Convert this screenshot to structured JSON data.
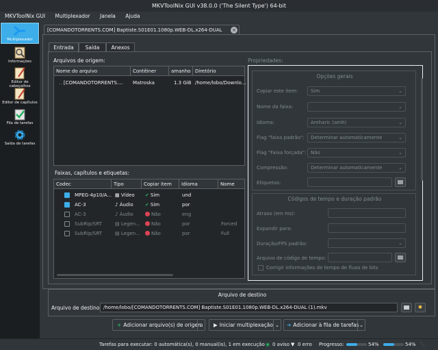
{
  "window": {
    "title": "MKVToolNix GUI v38.0.0 ('The Silent Type') 64-bit"
  },
  "menu": [
    "MKVToolNix GUI",
    "Multiplexador",
    "Janela",
    "Ajuda"
  ],
  "sidebar": [
    {
      "label": "Multiplexador",
      "icon": "multiplexer-icon",
      "active": true
    },
    {
      "label": "Informações",
      "icon": "info-icon"
    },
    {
      "label": "Editor de cabeçalhos",
      "icon": "header-editor-icon"
    },
    {
      "label": "Editor de capítulos",
      "icon": "chapter-editor-icon"
    },
    {
      "label": "Fila de tarefas",
      "icon": "job-queue-icon"
    },
    {
      "label": "Saída de tarefas",
      "icon": "job-output-icon"
    }
  ],
  "doc_tab": {
    "label": "[COMANDOTORRENTS.COM] Baptiste.S01E01.1080p.WEB-DL.x264-DUAL (1).mkv"
  },
  "subtabs": [
    "Entrada",
    "Saída",
    "Anexos"
  ],
  "source_files": {
    "label": "Arquivos de origem:",
    "columns": [
      "Nome do arquivo",
      "Contêiner",
      "amanho",
      "Diretório"
    ],
    "rows": [
      {
        "name": "[COMANDOTORRENTS....",
        "container": "Matroska",
        "size": "1.3 GiB",
        "dir": "/home/lobo/Downlo..."
      }
    ]
  },
  "tracks": {
    "label": "Faixas, capítulos e etiquetas:",
    "columns": [
      "Codec",
      "Tipo",
      "Copiar item",
      "Idioma",
      "Nome"
    ],
    "rows": [
      {
        "codec": "MPEG-4p10/A...",
        "type": "Vídeo",
        "copy": "Sim",
        "lang": "und",
        "name": "",
        "checked": true,
        "enabled": true
      },
      {
        "codec": "AC-3",
        "type": "Áudio",
        "copy": "Sim",
        "lang": "por",
        "name": "",
        "checked": true,
        "enabled": true
      },
      {
        "codec": "AC-3",
        "type": "Áudio",
        "copy": "Não",
        "lang": "eng",
        "name": "",
        "checked": false,
        "enabled": false
      },
      {
        "codec": "SubRip/SRT",
        "type": "Legen...",
        "copy": "Não",
        "lang": "por",
        "name": "Forced",
        "checked": false,
        "enabled": false
      },
      {
        "codec": "SubRip/SRT",
        "type": "Legen...",
        "copy": "Não",
        "lang": "por",
        "name": "Full",
        "checked": false,
        "enabled": false
      }
    ]
  },
  "properties": {
    "label": "Propriedades:",
    "general_title": "Opções gerais",
    "general": [
      {
        "label": "Copiar este item:",
        "value": "Sim",
        "kind": "select"
      },
      {
        "label": "Nome da faixa:",
        "value": "",
        "kind": "select"
      },
      {
        "label": "Idioma:",
        "value": "Amharic (amh)",
        "kind": "select"
      },
      {
        "label": "Flag \"faixa padrão\":",
        "value": "Determinar automaticamente",
        "kind": "select"
      },
      {
        "label": "Flag \"Faixa forçada\":",
        "value": "Não",
        "kind": "select"
      },
      {
        "label": "Compressão:",
        "value": "Determinar automaticamente",
        "kind": "select"
      },
      {
        "label": "Etiquetas:",
        "value": "",
        "kind": "file"
      }
    ],
    "timing_title": "Códigos de tempo e duração padrão",
    "timing": [
      {
        "label": "Atraso (em ms):",
        "value": "",
        "kind": "text"
      },
      {
        "label": "Expandir para:",
        "value": "",
        "kind": "text"
      },
      {
        "label": "Duração/FPS padrão:",
        "value": "",
        "kind": "select"
      },
      {
        "label": "Arquivo de código de tempo:",
        "value": "",
        "kind": "file"
      }
    ],
    "fix_timing_label": "Corrigir informações de tempo de fluxo de bits"
  },
  "destination": {
    "title": "Arquivo de destino",
    "label": "Arquivo de destino:",
    "path": "/home/lobo/[COMANDOTORRENTS.COM] Baptiste.S01E01.1080p.WEB-DL.x264-DUAL (1).mkv"
  },
  "actions": {
    "add_source": "Adicionar arquivo(s) de origem",
    "start_mux": "Iniciar multiplexação",
    "add_queue": "Adicionar à fila de tarefas"
  },
  "status": {
    "tasks": "Tarefas para executar:  0 automática(s), 0 manual(is), 1 em execução",
    "warnings": "0 aviso",
    "errors": "0 erro",
    "progress_label": "Progresso:",
    "progress1": "54%",
    "progress2": "54%",
    "progress_fraction": 0.54
  },
  "colors": {
    "accent": "#3daee9",
    "ok": "#27ae60",
    "error": "#da4453"
  }
}
